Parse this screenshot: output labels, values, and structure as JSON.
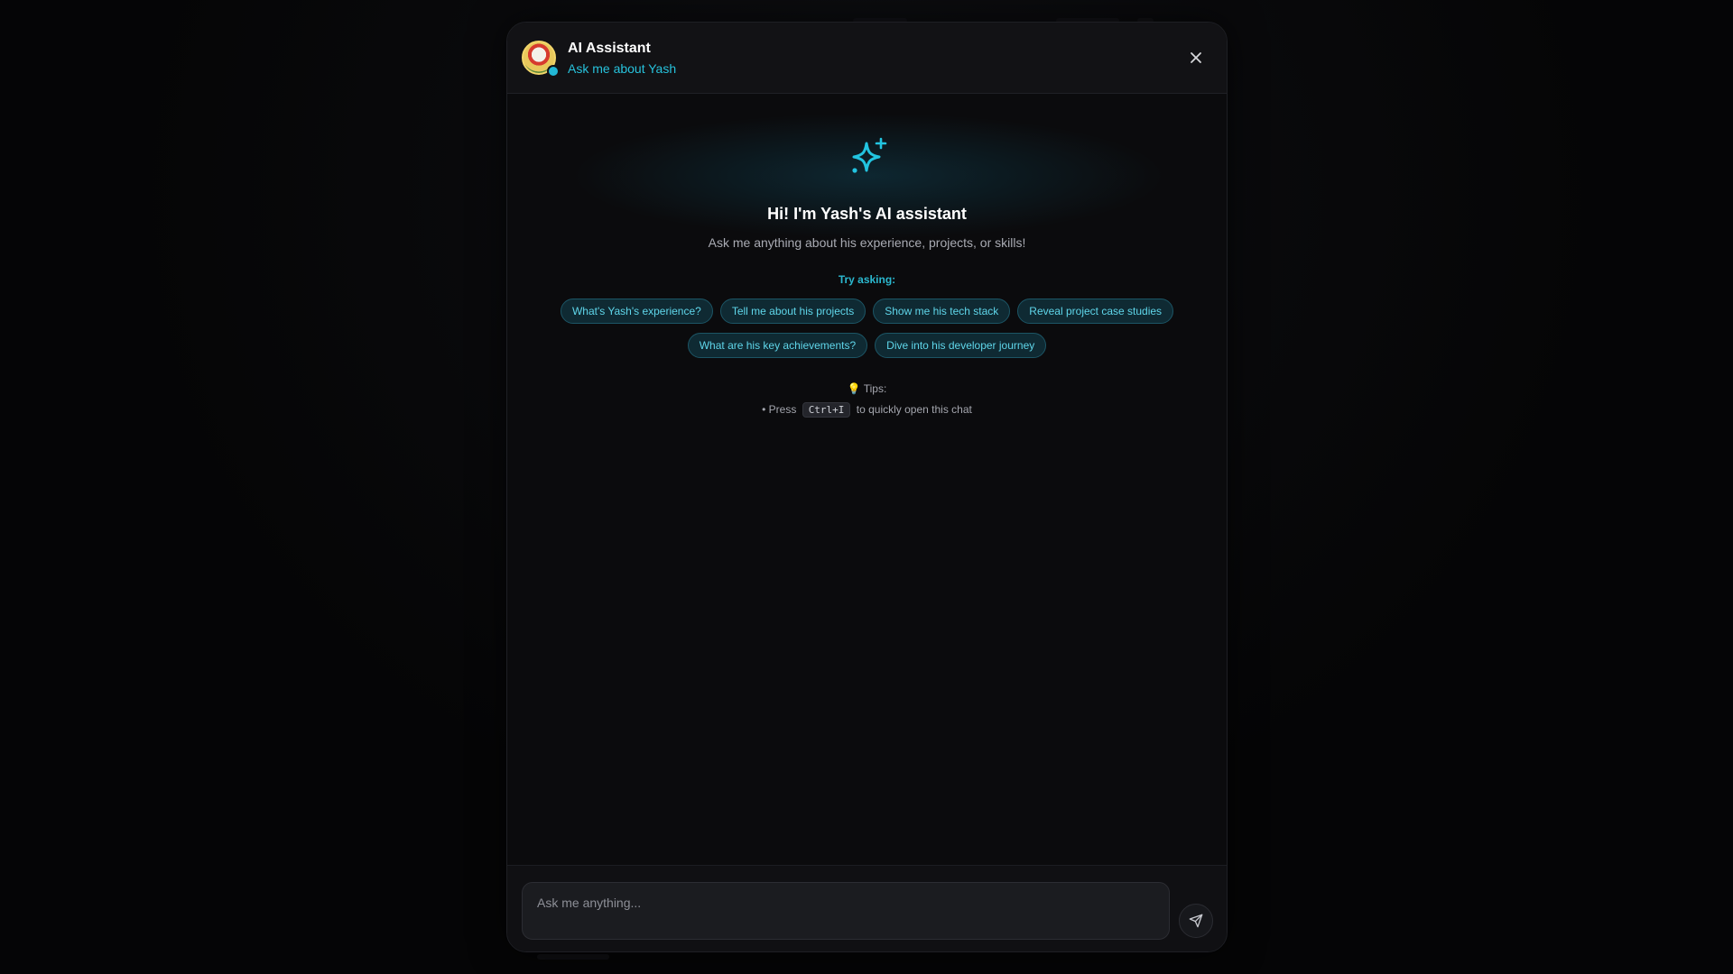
{
  "header": {
    "title": "AI Assistant",
    "subtitle": "Ask me about Yash",
    "avatar_icon": "avatar-icon",
    "status_color": "#22b8d6",
    "close_icon": "close-icon"
  },
  "welcome": {
    "icon": "sparkle-icon",
    "title": "Hi! I'm Yash's AI assistant",
    "subtitle": "Ask me anything about his experience, projects, or skills!"
  },
  "suggestions": {
    "label": "Try asking:",
    "row1": [
      "What's Yash's experience?",
      "Tell me about his projects",
      "Show me his tech stack",
      "Reveal project case studies"
    ],
    "row2": [
      "What are his key achievements?",
      "Dive into his developer journey"
    ]
  },
  "tips": {
    "label": "💡 Tips:",
    "line_prefix": "• Press",
    "shortcut": "Ctrl+I",
    "line_suffix": "to quickly open this chat"
  },
  "composer": {
    "placeholder": "Ask me anything...",
    "value": "",
    "send_icon": "send-icon"
  },
  "colors": {
    "accent": "#27c2dc",
    "chip_bg": "#0f2a33",
    "window_bg": "#0b0b0d"
  }
}
